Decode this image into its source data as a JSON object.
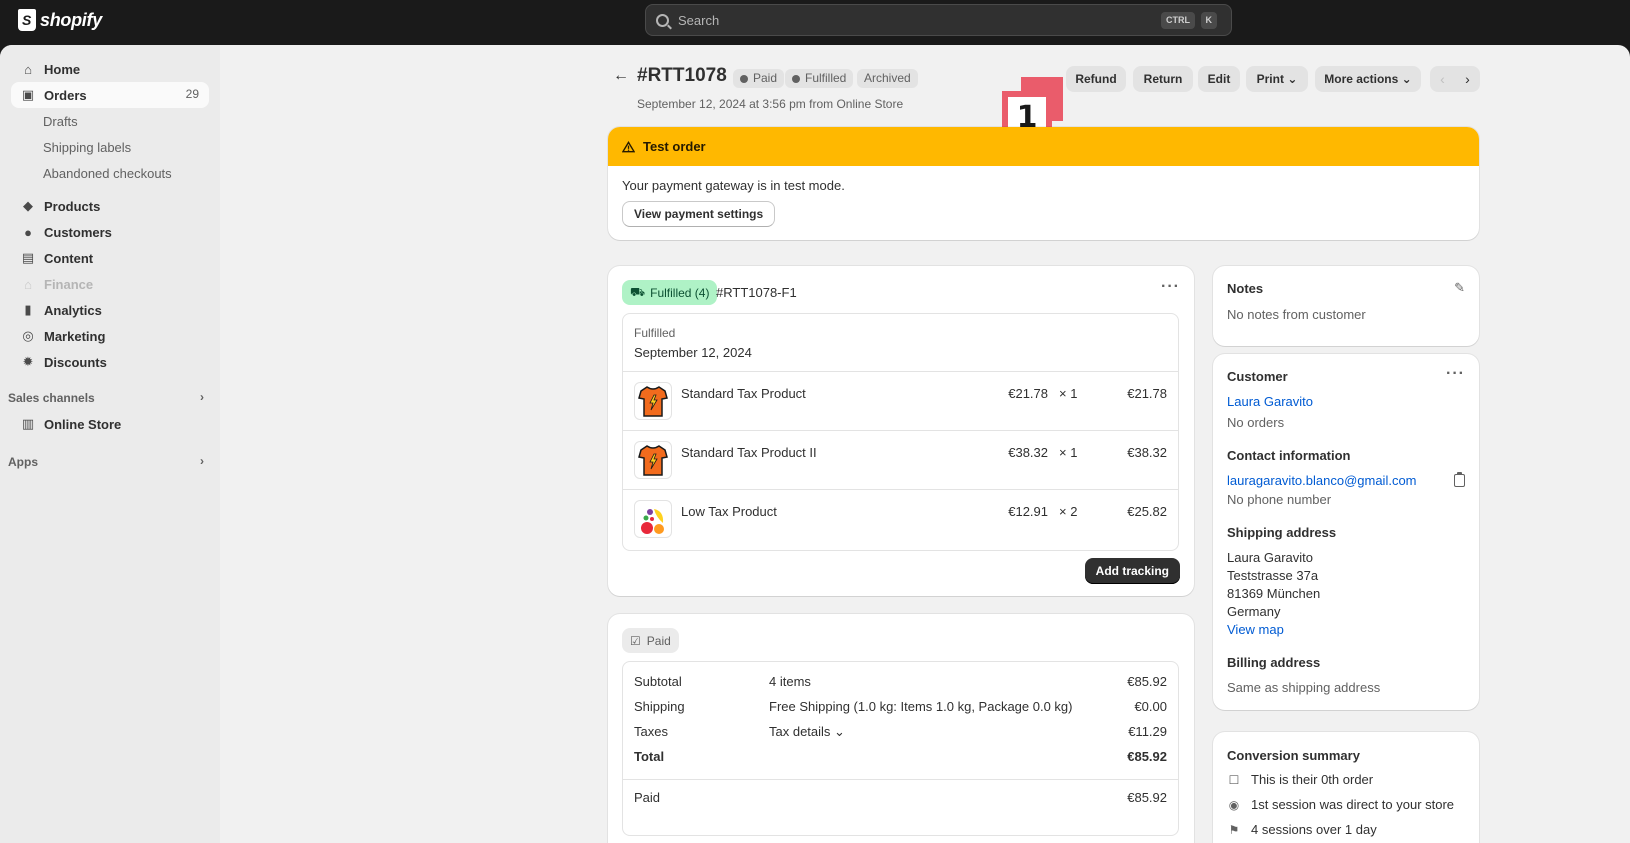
{
  "topbar": {
    "brand": "shopify",
    "search_placeholder": "Search",
    "kbd_ctrl": "CTRL",
    "kbd_k": "K"
  },
  "sidebar": {
    "home": "Home",
    "orders": "Orders",
    "orders_count": "29",
    "drafts": "Drafts",
    "shipping_labels": "Shipping labels",
    "abandoned": "Abandoned checkouts",
    "products": "Products",
    "customers": "Customers",
    "content": "Content",
    "finance": "Finance",
    "analytics": "Analytics",
    "marketing": "Marketing",
    "discounts": "Discounts",
    "sales_channels": "Sales channels",
    "online_store": "Online Store",
    "apps": "Apps"
  },
  "order": {
    "title": "#RTT1078",
    "badge_paid": "Paid",
    "badge_fulfilled": "Fulfilled",
    "badge_archived": "Archived",
    "subtitle": "September 12, 2024 at 3:56 pm from Online Store",
    "actions": {
      "refund": "Refund",
      "return": "Return",
      "edit": "Edit",
      "print": "Print",
      "more": "More actions"
    },
    "marker_number": "1"
  },
  "banner": {
    "title": "Test order",
    "message": "Your payment gateway is in test mode.",
    "button": "View payment settings"
  },
  "fulfillment": {
    "status": "Fulfilled (4)",
    "id": "#RTT1078-F1",
    "label": "Fulfilled",
    "date": "September 12, 2024",
    "items": [
      {
        "name": "Standard Tax Product",
        "price": "€21.78",
        "qty": "× 1",
        "total": "€21.78",
        "thumb": "orange-shirt"
      },
      {
        "name": "Standard Tax Product II",
        "price": "€38.32",
        "qty": "× 1",
        "total": "€38.32",
        "thumb": "orange-shirt"
      },
      {
        "name": "Low Tax Product",
        "price": "€12.91",
        "qty": "× 2",
        "total": "€25.82",
        "thumb": "fruit"
      }
    ],
    "add_tracking": "Add tracking"
  },
  "payment": {
    "status": "Paid",
    "subtotal_label": "Subtotal",
    "subtotal_mid": "4 items",
    "subtotal_value": "€85.92",
    "shipping_label": "Shipping",
    "shipping_mid": "Free Shipping (1.0 kg: Items 1.0 kg, Package 0.0 kg)",
    "shipping_value": "€0.00",
    "taxes_label": "Taxes",
    "taxes_mid": "Tax details",
    "taxes_value": "€11.29",
    "total_label": "Total",
    "total_value": "€85.92",
    "paid_label": "Paid",
    "paid_value": "€85.92"
  },
  "notes": {
    "title": "Notes",
    "text": "No notes from customer"
  },
  "customer": {
    "title": "Customer",
    "name": "Laura Garavito",
    "orders": "No orders",
    "contact_title": "Contact information",
    "email": "lauragaravito.blanco@gmail.com",
    "phone": "No phone number",
    "shipping_title": "Shipping address",
    "address": [
      "Laura Garavito",
      "Teststrasse 37a",
      "81369 München",
      "Germany"
    ],
    "view_map": "View map",
    "billing_title": "Billing address",
    "billing_text": "Same as shipping address"
  },
  "conversion": {
    "title": "Conversion summary",
    "rows": [
      "This is their 0th order",
      "1st session was direct to your store",
      "4 sessions over 1 day"
    ]
  },
  "colors": {
    "banner": "#ffb800",
    "fulfilled_pill": "#aff2c6",
    "link": "#005bd3",
    "marker": "#ea5c6b"
  }
}
